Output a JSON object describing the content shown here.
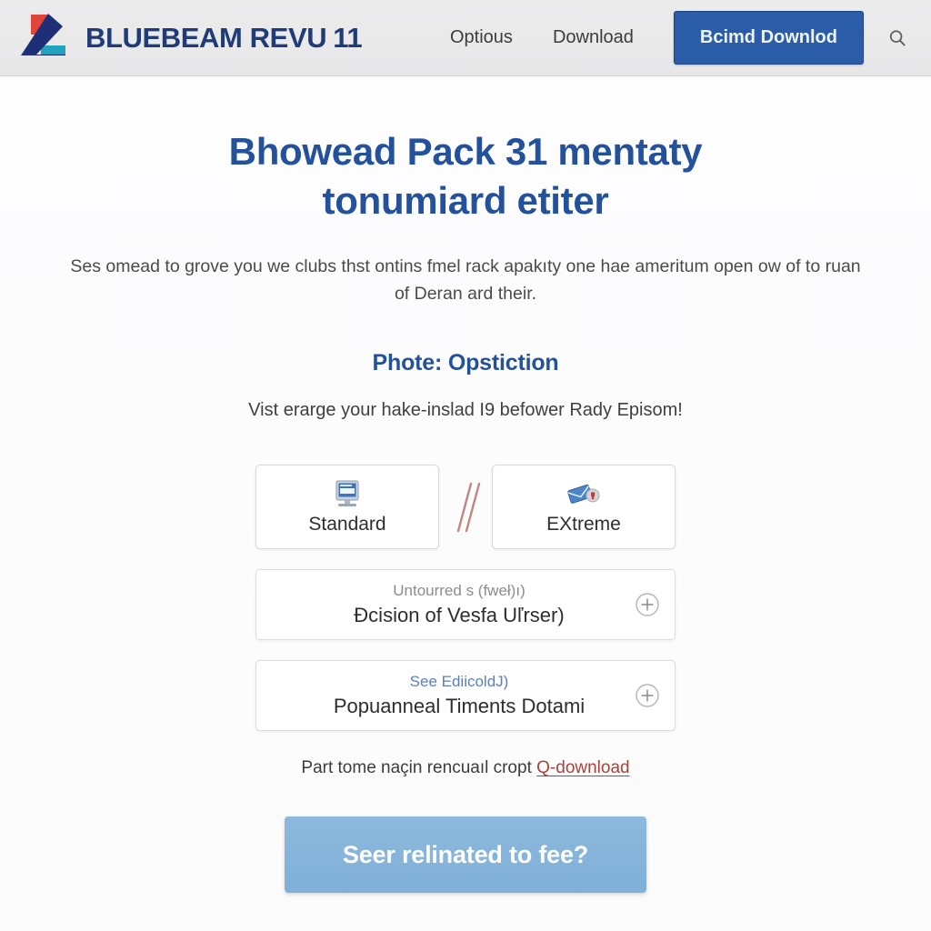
{
  "header": {
    "logo_icon": "bluebeam-logo-icon",
    "logo_colors": {
      "red": "#e0453c",
      "navy": "#1e2f78",
      "teal": "#21a3bd"
    },
    "brand_name": "BLUEBEAM REVU",
    "brand_version": "11",
    "nav_items": [
      {
        "label": "Optious"
      },
      {
        "label": "Download"
      }
    ],
    "cta_label": "Bcimd Downlod",
    "cta_color": "#2a5ca8",
    "search_icon": "search-icon"
  },
  "main": {
    "hero_title": "Bhowead Pack 31 mentaty tonumiard etiter",
    "hero_subtitle": "Ses omead to ɡrove you we clubs thst ontins fmel rack apakıty one hae ameritum open ow of to ruan of Deran ard their.",
    "section_title": "Phote: Opstiction",
    "section_subtitle": "Vist erarge your hake-inslad I9 befower Rady Episom!",
    "options": [
      {
        "label": "Standard",
        "icon": "monitor-icon"
      },
      {
        "label": "EXtreme",
        "icon": "envelope-badge-icon"
      }
    ],
    "divider_icon": "double-slash-divider-icon",
    "divider_color": "#c4837f",
    "accordion_rows": [
      {
        "eyebrow": "Untourred s (fweł)ı)",
        "eyebrow_style": "muted",
        "main": "Ðcision of Vesfa Uľrser)",
        "expand_icon": "plus-circle-icon"
      },
      {
        "eyebrow": "See EdiicoldJ)",
        "eyebrow_style": "link",
        "main": "Popuanneal Timents Dotami",
        "expand_icon": "plus-circle-icon"
      }
    ],
    "note_text": "Part tome naçin rencuaıl cropt ",
    "note_link": "Q-download",
    "note_link_color": "#a8423c",
    "bottom_cta_label": "Seer relinated to fee?",
    "bottom_cta_color": "#86b4da"
  }
}
